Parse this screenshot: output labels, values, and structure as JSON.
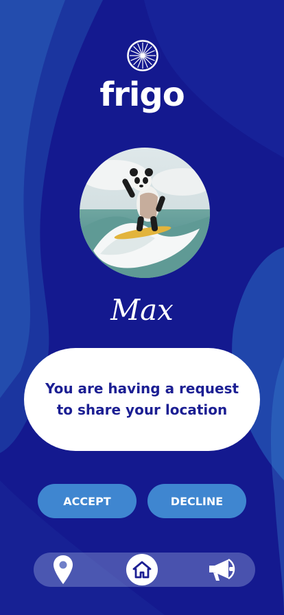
{
  "app": {
    "brand": "frigo",
    "icons": {
      "logo": "wheel-icon",
      "location": "location-pin-icon",
      "home": "home-icon",
      "announce": "megaphone-icon"
    }
  },
  "profile": {
    "name": "Max",
    "avatar": "panda-surfing-avatar"
  },
  "request": {
    "message": "You are having a request to share your location"
  },
  "actions": {
    "accept_label": "ACCEPT",
    "decline_label": "DECLINE"
  },
  "colors": {
    "background": "#14198f",
    "button": "#3f86d0",
    "message_text": "#1c1f93",
    "card": "#ffffff"
  }
}
